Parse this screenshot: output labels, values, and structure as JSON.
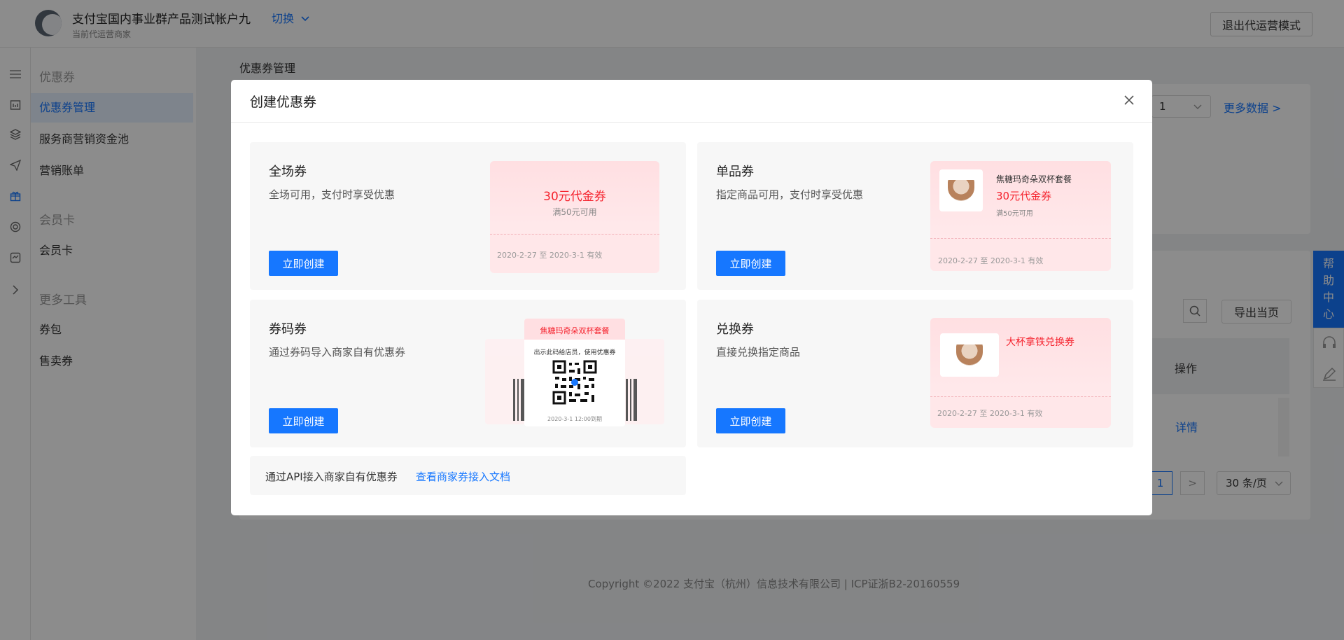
{
  "header": {
    "merchant_name": "支付宝国内事业群产品测试帐户九",
    "switch_label": "切换",
    "merchant_sub": "当前代运营商家",
    "exit_label": "退出代运营模式"
  },
  "sidebar": {
    "groups": [
      {
        "title": "优惠券",
        "items": [
          "优惠券管理",
          "服务商营销资金池",
          "营销账单"
        ]
      },
      {
        "title": "会员卡",
        "items": [
          "会员卡"
        ]
      },
      {
        "title": "更多工具",
        "items": [
          "券包",
          "售卖券"
        ]
      }
    ],
    "active_item": "优惠券管理"
  },
  "main": {
    "breadcrumb": "优惠券管理",
    "period_value": "1",
    "more_data": "更多数据 >",
    "export_label": "导出当页",
    "col_operation": "操作",
    "detail_link": "详情",
    "current_page": "1",
    "next_page": ">",
    "page_size": "30 条/页"
  },
  "help": {
    "label_chars": [
      "帮",
      "助",
      "中",
      "心"
    ]
  },
  "footer": "Copyright ©2022 支付宝（杭州）信息技术有限公司  |  ICP证浙B2-20160559",
  "modal": {
    "title": "创建优惠券",
    "create_label": "立即创建",
    "options": [
      {
        "title": "全场券",
        "desc": "全场可用，支付时享受优惠",
        "preview": {
          "amount": "30元代金券",
          "condition": "满50元可用",
          "date": "2020-2-27 至 2020-3-1 有效"
        }
      },
      {
        "title": "单品券",
        "desc": "指定商品可用，支付时享受优惠",
        "preview": {
          "product": "焦糖玛奇朵双杯套餐",
          "amount": "30元代金券",
          "condition": "满50元可用",
          "date": "2020-2-27 至 2020-3-1 有效"
        }
      },
      {
        "title": "券码券",
        "desc": "通过券码导入商家自有优惠券",
        "preview": {
          "product": "焦糖玛奇朵双杯套餐",
          "hint": "出示此码给店员，使用优惠券",
          "date": "2020-3-1 12:00到期"
        }
      },
      {
        "title": "兑换券",
        "desc": "直接兑换指定商品",
        "preview": {
          "product": "大杯拿铁兑换券",
          "date": "2020-2-27 至 2020-3-1 有效"
        }
      }
    ],
    "api_text": "通过API接入商家自有优惠券",
    "api_link": "查看商家券接入文档"
  },
  "colors": {
    "primary": "#1677ff",
    "coupon_red": "#f5222d",
    "coupon_bg": "#ffe7e9"
  },
  "icons": [
    "menu-icon",
    "store-icon",
    "cube-icon",
    "send-icon",
    "gift-icon",
    "target-icon",
    "shop-icon",
    "chevron-right-icon",
    "search-icon",
    "close-icon",
    "chevron-down-icon"
  ]
}
